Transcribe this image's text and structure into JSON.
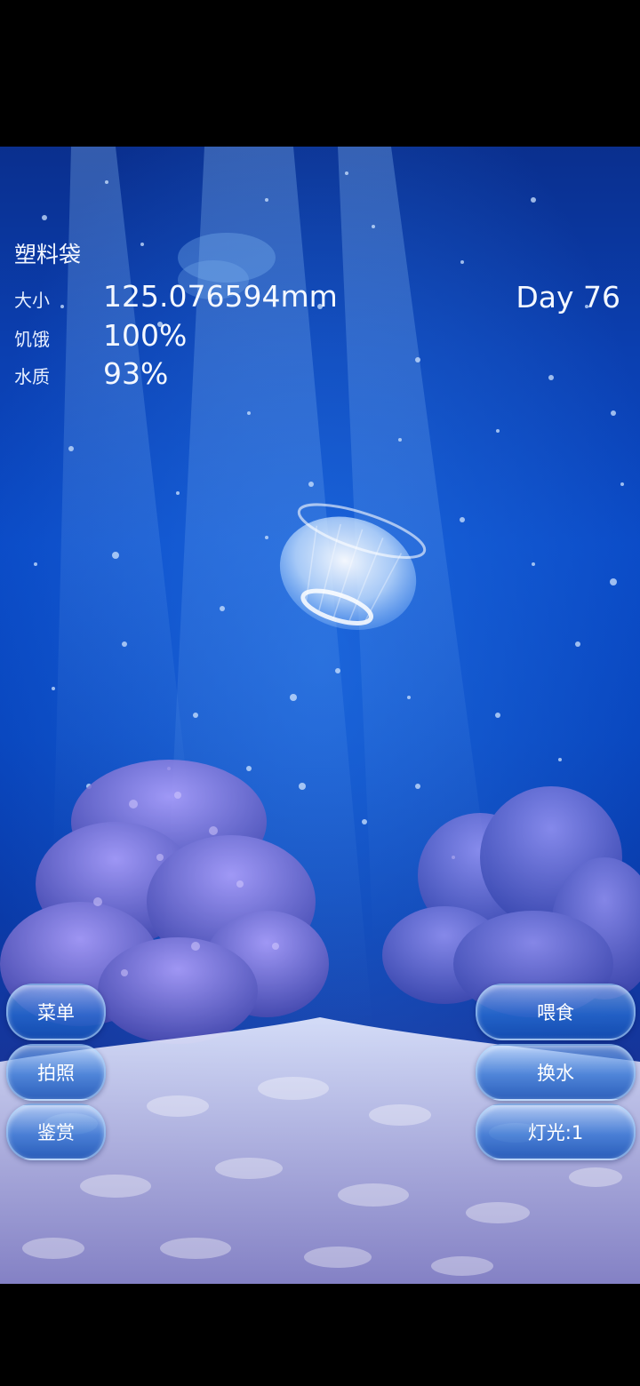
{
  "jellyfish": {
    "name": "塑料袋",
    "size_label": "大小",
    "size_value": "125.076594mm",
    "hunger_label": "饥饿",
    "hunger_value": "100%",
    "water_label": "水质",
    "water_value": "93%",
    "day": "Day 76"
  },
  "left_menu": {
    "menu_label": "菜单",
    "photo_label": "拍照",
    "gallery_label": "鉴赏"
  },
  "right_menu": {
    "feed_label": "喂食",
    "water_change_label": "换水",
    "light_label": "灯光:1"
  },
  "colors": {
    "water_top": "#0a2f8e",
    "water_mid": "#0a4ac6",
    "sand": "#c9c9ee",
    "coral": "#8c78d8"
  }
}
